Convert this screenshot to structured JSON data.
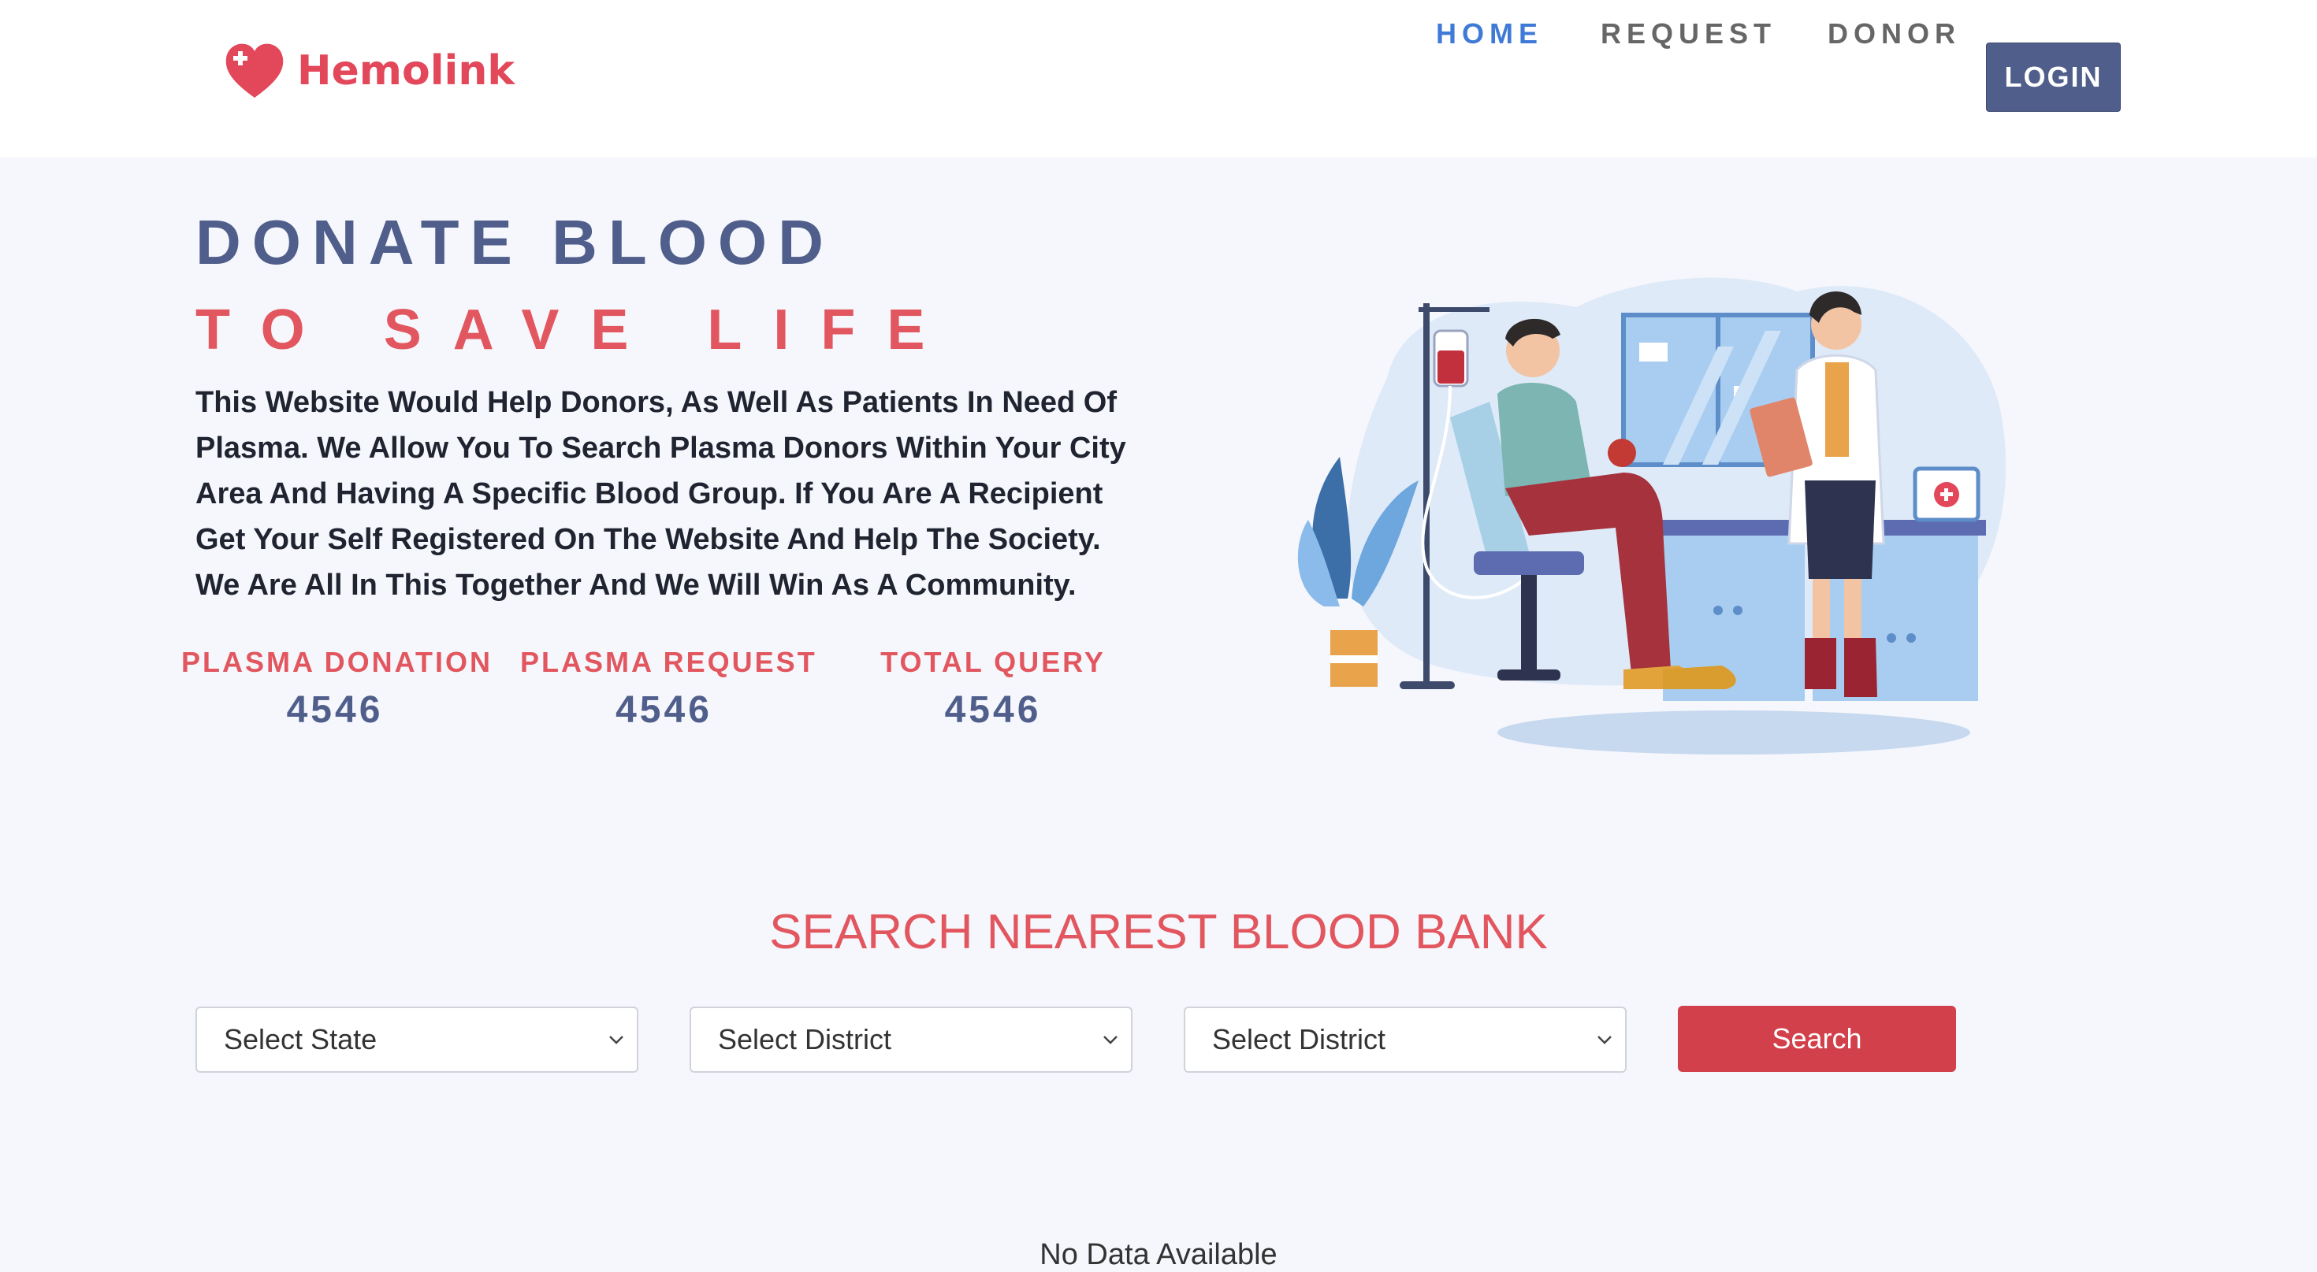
{
  "brand": {
    "name": "Hemolink",
    "color": "#e2475a",
    "logo_icon": "heart-plus-icon"
  },
  "nav": {
    "items": [
      {
        "label": "HOME",
        "active": true
      },
      {
        "label": "REQUEST",
        "active": false
      },
      {
        "label": "DONOR",
        "active": false
      }
    ],
    "login_label": "LOGIN"
  },
  "hero": {
    "title_line1": "DONATE BLOOD",
    "title_line2": "TO SAVE LIFE",
    "description": "This Website Would Help Donors, As Well As Patients In Need Of Plasma. We Allow You To Search Plasma Donors Within Your City Area And Having A Specific Blood Group. If You Are A Recipient Get Your Self Registered On The Website And Help The Society. We Are All In This Together And We Will Win As A Community.",
    "stats": [
      {
        "label": "PLASMA DONATION",
        "value": "4546"
      },
      {
        "label": "PLASMA REQUEST",
        "value": "4546"
      },
      {
        "label": "TOTAL QUERY",
        "value": "4546"
      }
    ],
    "illustration_icon": "blood-donation-illustration"
  },
  "search": {
    "title": "SEARCH NEAREST BLOOD BANK",
    "state_select": "Select State",
    "district_select_1": "Select District",
    "district_select_2": "Select District",
    "button_label": "Search"
  },
  "results": {
    "empty_text": "No Data Available"
  },
  "colors": {
    "primary": "#4f5e8a",
    "accent": "#e2575f",
    "active_link": "#3f7bd6",
    "button_red": "#d1404b",
    "background": "#f6f7fc"
  }
}
